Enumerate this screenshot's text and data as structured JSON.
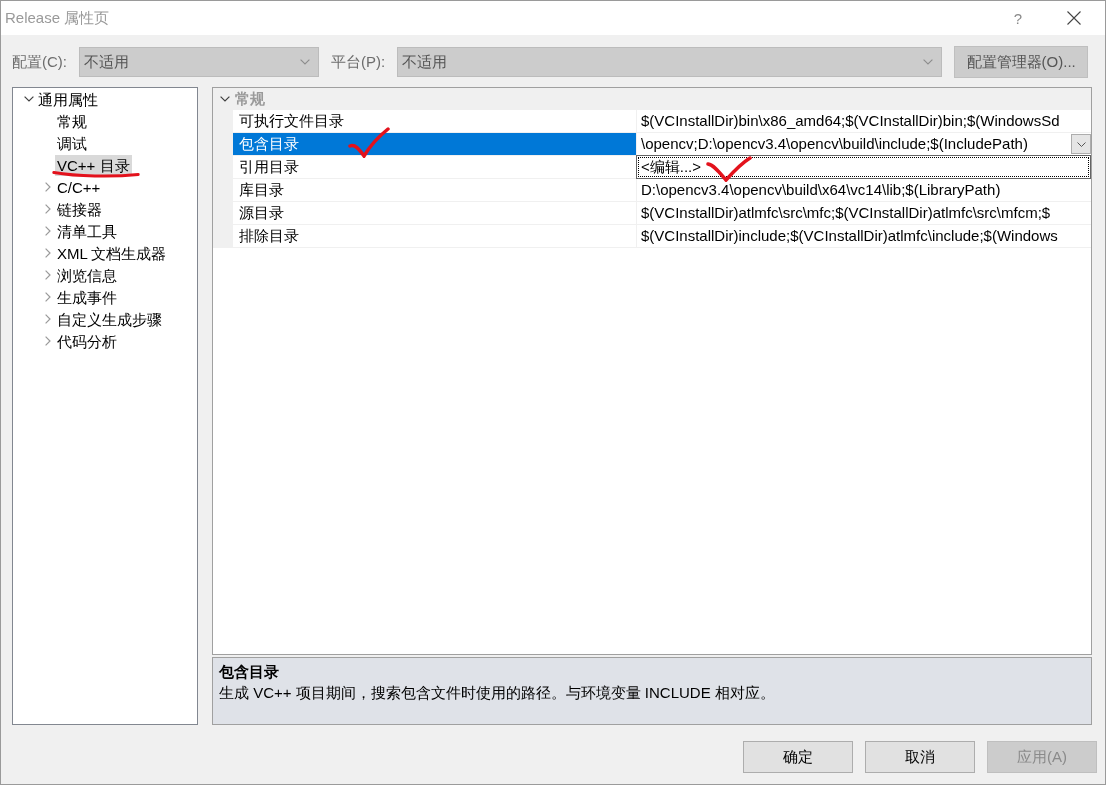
{
  "window": {
    "title": "Release 属性页",
    "help": "?"
  },
  "toolbar": {
    "configuration": {
      "label": "配置(C):",
      "value": "不适用",
      "disabled": true
    },
    "platform": {
      "label": "平台(P):",
      "value": "不适用",
      "disabled": true
    },
    "manager_button": {
      "label": "配置管理器(O)...",
      "disabled": true
    }
  },
  "sidebar": {
    "items": [
      {
        "label": "通用属性",
        "kind": "group",
        "expanded": true,
        "selected": false,
        "children": [
          {
            "label": "常规",
            "kind": "page",
            "selected": false
          },
          {
            "label": "调试",
            "kind": "page",
            "selected": false
          },
          {
            "label": "VC++ 目录",
            "kind": "page",
            "selected": true
          },
          {
            "label": "C/C++",
            "kind": "group",
            "expanded": false,
            "selected": false
          },
          {
            "label": "链接器",
            "kind": "group",
            "expanded": false,
            "selected": false
          },
          {
            "label": "清单工具",
            "kind": "group",
            "expanded": false,
            "selected": false
          },
          {
            "label": "XML 文档生成器",
            "kind": "group",
            "expanded": false,
            "selected": false
          },
          {
            "label": "浏览信息",
            "kind": "group",
            "expanded": false,
            "selected": false
          },
          {
            "label": "生成事件",
            "kind": "group",
            "expanded": false,
            "selected": false
          },
          {
            "label": "自定义生成步骤",
            "kind": "group",
            "expanded": false,
            "selected": false
          },
          {
            "label": "代码分析",
            "kind": "group",
            "expanded": false,
            "selected": false
          }
        ]
      }
    ]
  },
  "property_grid": {
    "categories": [
      {
        "label": "常规",
        "expanded": true,
        "rows": [
          {
            "name": "可执行文件目录",
            "value": "$(VCInstallDir)bin\\x86_amd64;$(VCInstallDir)bin;$(WindowsSd",
            "selected": false
          },
          {
            "name": "包含目录",
            "value": "\\opencv;D:\\opencv3.4\\opencv\\build\\include;$(IncludePath)",
            "selected": true
          },
          {
            "name": "引用目录",
            "selected": false
          },
          {
            "name": "库目录",
            "value": "D:\\opencv3.4\\opencv\\build\\x64\\vc14\\lib;$(LibraryPath)",
            "selected": false
          },
          {
            "name": "源目录",
            "value": "$(VCInstallDir)atlmfc\\src\\mfc;$(VCInstallDir)atlmfc\\src\\mfcm;$",
            "selected": false
          },
          {
            "name": "排除目录",
            "value": "$(VCInstallDir)include;$(VCInstallDir)atlmfc\\include;$(Windows",
            "selected": false
          }
        ]
      }
    ],
    "value_dropdown": {
      "items": [
        {
          "label": "<编辑...>",
          "focused": true
        }
      ]
    }
  },
  "description": {
    "title": "包含目录",
    "text": "生成 VC++ 项目期间，搜索包含文件时使用的路径。与环境变量 INCLUDE 相对应。"
  },
  "buttons": [
    {
      "label": "确定",
      "disabled": false
    },
    {
      "label": "取消",
      "disabled": false
    },
    {
      "label": "应用(A)",
      "disabled": true
    }
  ]
}
